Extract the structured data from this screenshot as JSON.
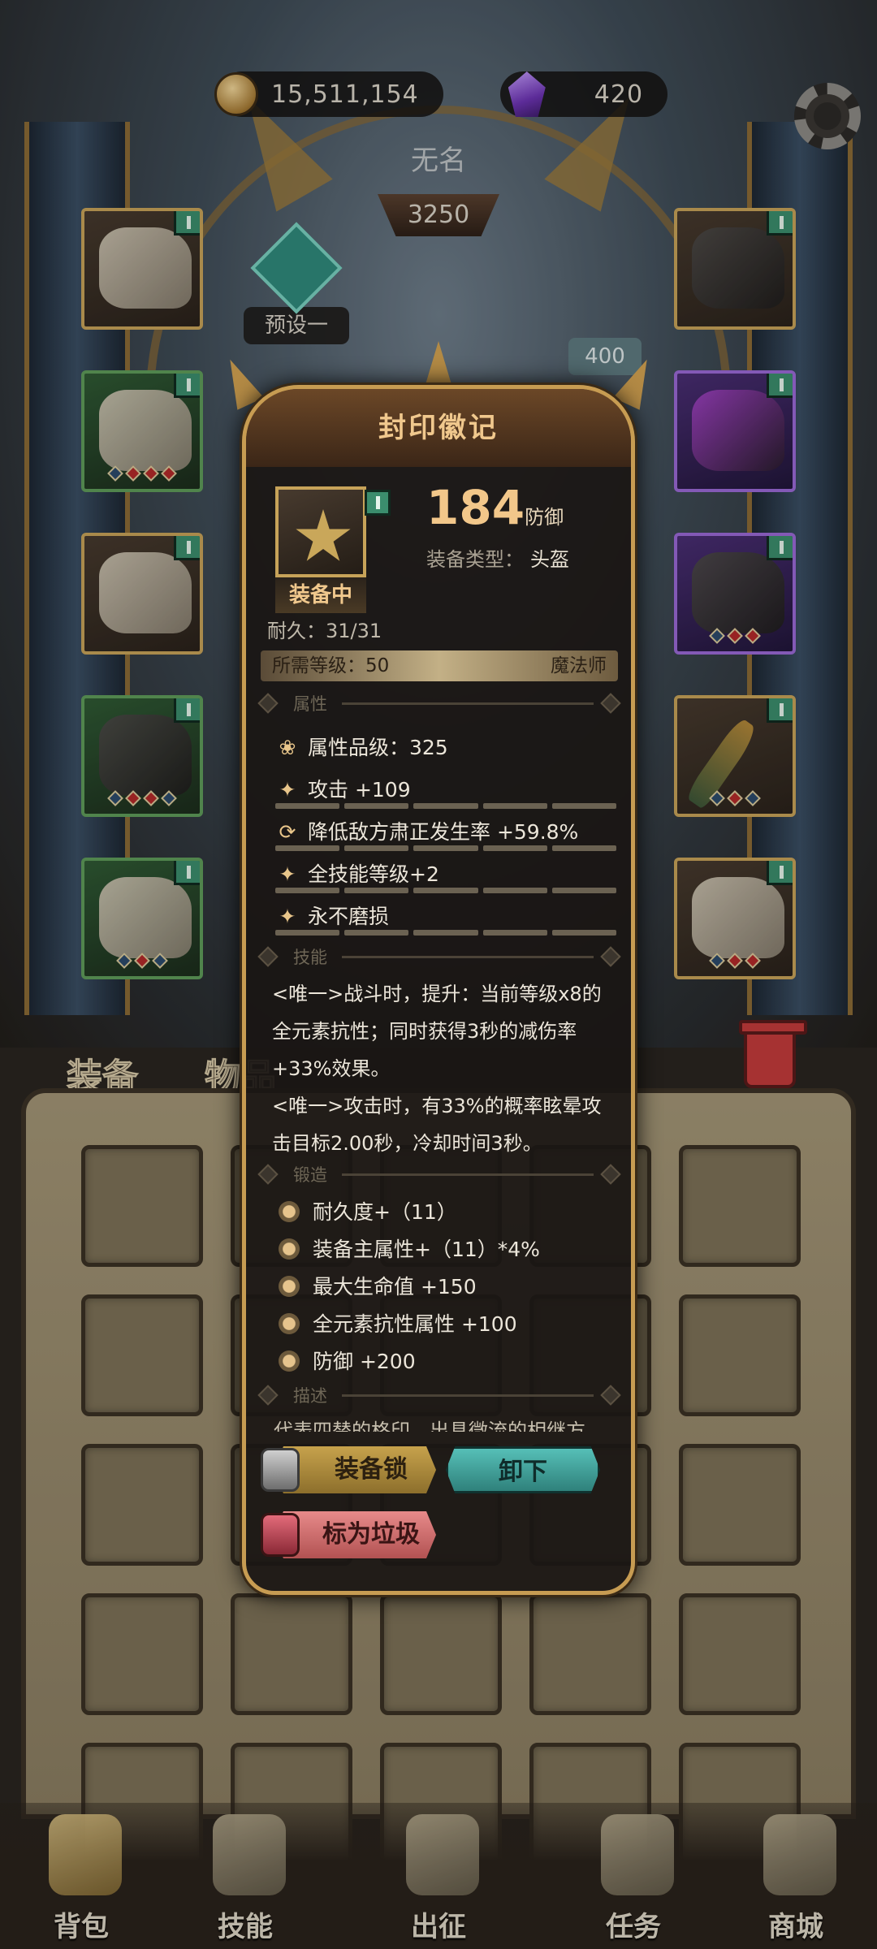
{
  "currency": {
    "gold": "15,511,154",
    "gems": "420"
  },
  "hero": {
    "name": "无名",
    "power": "3250",
    "preset": "预设一",
    "side_value": "400"
  },
  "tabs": {
    "equipment": "装备",
    "items": "物品"
  },
  "modal": {
    "title": "封印徽记",
    "equipped_label": "装备中",
    "main_stat_value": "184",
    "main_stat_name": "防御",
    "type_label": "装备类型：",
    "type_value": "头盔",
    "durability": "耐久：31/31",
    "req_level": "所需等级：50",
    "req_class": "魔法师",
    "sections": {
      "attr": "属性",
      "skill": "技能",
      "forge": "锻造",
      "desc": "描述"
    },
    "attr_rank": "属性品级：325",
    "attrs": [
      "攻击 +109",
      "降低敌方肃正发生率 +59.8%",
      "全技能等级+2",
      "永不磨损"
    ],
    "skills": [
      "<唯一>战斗时，提升：当前等级x8的",
      "全元素抗性；同时获得3秒的减伤率",
      "+33%效果。",
      "<唯一>攻击时，有33%的概率眩晕攻",
      "击目标2.00秒，冷却时间3秒。"
    ],
    "forge": [
      "耐久度+（11）",
      "装备主属性+（11）*4%",
      "最大生命值 +150",
      "全元素抗性属性 +100",
      "防御 +200"
    ],
    "description": "代表四替的格印，出具微流的相继方",
    "buttons": {
      "lock": "装备锁",
      "unequip": "卸下",
      "trash": "标为垃圾"
    }
  },
  "nav": {
    "bag": "背包",
    "skills": "技能",
    "expedition": "出征",
    "tasks": "任务",
    "shop": "商城"
  }
}
